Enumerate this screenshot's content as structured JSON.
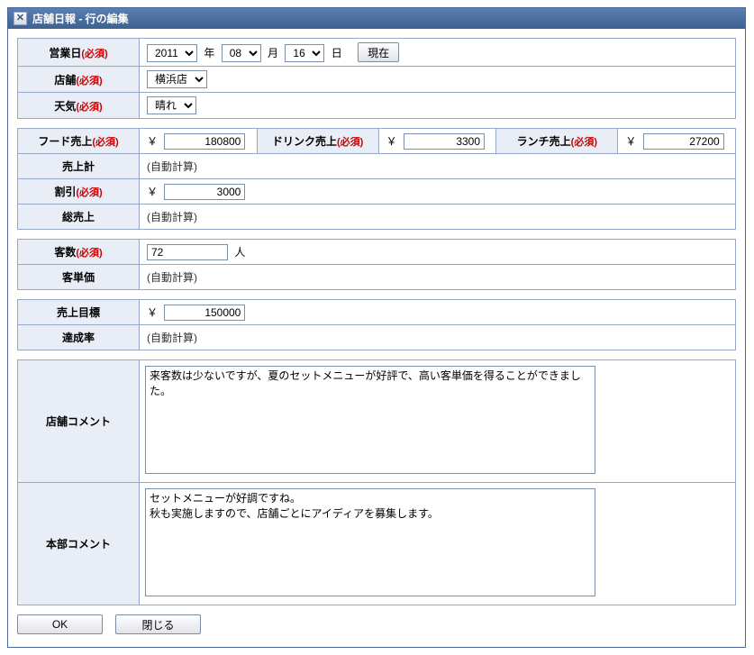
{
  "title": "店舗日報 - 行の編集",
  "required_marker": "(必須)",
  "labels": {
    "business_day": "営業日",
    "store": "店舗",
    "weather": "天気",
    "food_sales": "フード売上",
    "drink_sales": "ドリンク売上",
    "lunch_sales": "ランチ売上",
    "sales_total": "売上計",
    "discount": "割引",
    "gross_sales": "総売上",
    "customers": "客数",
    "avg_spend": "客単価",
    "sales_target": "売上目標",
    "achievement": "達成率",
    "store_comment": "店舗コメント",
    "hq_comment": "本部コメント"
  },
  "units": {
    "year": "年",
    "month": "月",
    "day": "日",
    "yen": "￥",
    "people": "人"
  },
  "buttons": {
    "now": "現在",
    "ok": "OK",
    "close": "閉じる"
  },
  "values": {
    "year": "2011",
    "month": "08",
    "day": "16",
    "store": "横浜店",
    "weather": "晴れ",
    "food_sales": "180800",
    "drink_sales": "3300",
    "lunch_sales": "27200",
    "auto_calc": "(自動計算)",
    "discount": "3000",
    "customers": "72",
    "sales_target": "150000",
    "store_comment": "来客数は少ないですが、夏のセットメニューが好評で、高い客単価を得ることができました。",
    "hq_comment": "セットメニューが好調ですね。\n秋も実施しますので、店舗ごとにアイディアを募集します。"
  }
}
